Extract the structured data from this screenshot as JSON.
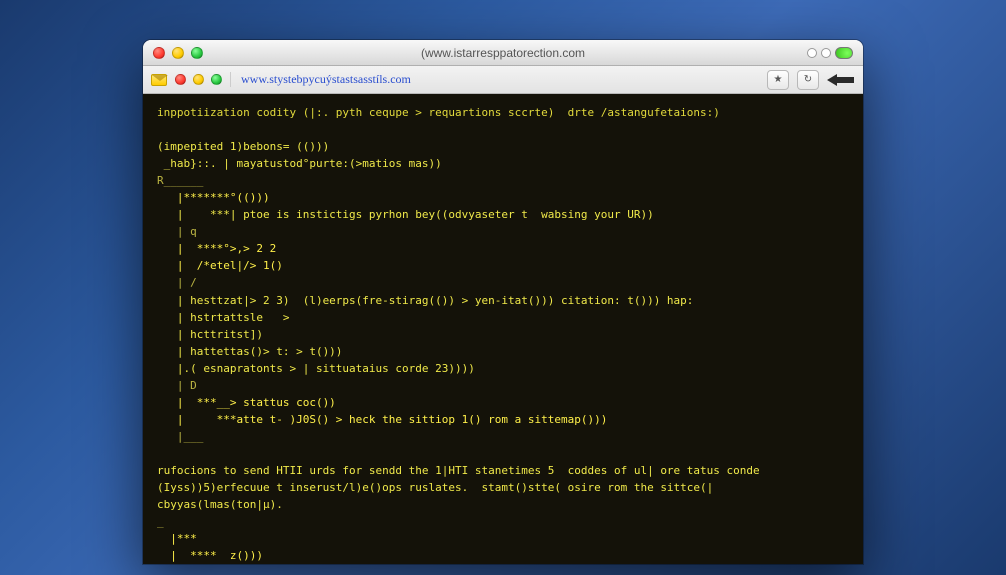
{
  "titlebar": {
    "title": "(www.istarresppatorection.com"
  },
  "toolbar": {
    "url": "www.stystebpycuýstastsasstíls.com"
  },
  "terminal": {
    "l01": "inppotiization codity (|:. pyth cequpe > requartions sccrte)  drte /astangufetaions:)",
    "l02": "",
    "l03": "(impepited 1)bebons= (()))",
    "l04": " _hab}::. | mayatustod°purte:(>matios mas))",
    "l05": "R______",
    "l06": "   |*******°(()))",
    "l07": "   |    ***| ptoe is instictigs pyrhon bey((odvyaseter t  wabsing your UR))",
    "l08": "   | q",
    "l09": "   |  ****°>,> 2 2",
    "l10": "   |  /*etel|/> 1()",
    "l11": "   | /",
    "l12": "   | hesttzat|> 2 3)  (l)eerps(fre-stirag(()) > yen-itat())) citation: t())) hap:",
    "l13": "   | hstrtattsle   >",
    "l14": "   | hcttritst])",
    "l15": "   | hattettas()> t: > t()))",
    "l16": "   |.( esnapratonts > | sittuataius corde 23))))",
    "l17": "   | D",
    "l18": "   |  ***__> stattus coc())",
    "l19": "   |     ***atte t- )J0S() > heck the sittiop 1() rom a sittemap()))",
    "l20": "   |___",
    "l21": "",
    "l22": "rufocions to send HTII urds for sendd the 1|HTI stanetimes 5  coddes of ul| ore tatus conde",
    "l23": "(Iyss))5)erfecuue t inserust/l)e()ops ruslates.  stamt()stte( osire rom the sittce(|",
    "l24": "cbyyas(lmas(ton|µ).",
    "l25": "_",
    "l26": "  |***",
    "l27": "  |  ****  z()))"
  }
}
